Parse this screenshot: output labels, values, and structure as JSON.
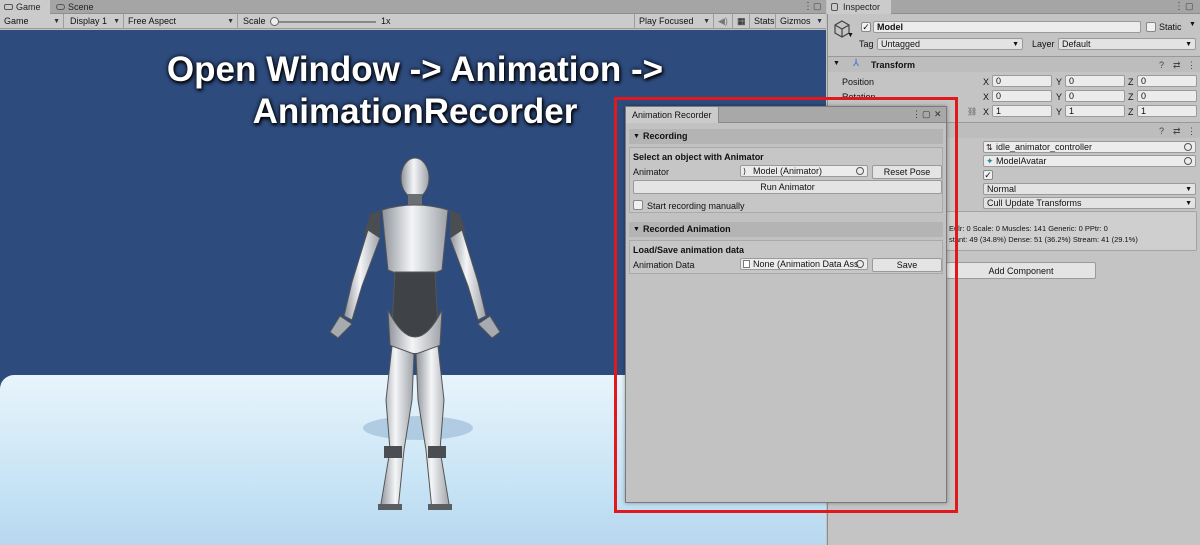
{
  "game_tabs": [
    {
      "label": "Game",
      "active": true
    },
    {
      "label": "Scene",
      "active": false
    }
  ],
  "toolbar": {
    "game_dropdown": "Game",
    "display_dropdown": "Display 1",
    "aspect_dropdown": "Free Aspect",
    "scale_label": "Scale",
    "scale_value": "1x",
    "scale_fraction": 0.0,
    "play_mode_dropdown": "Play Focused",
    "stats_label": "Stats",
    "gizmos_label": "Gizmos"
  },
  "overlay": {
    "line1": "Open Window -> Animation ->",
    "line2": "AnimationRecorder"
  },
  "inspector": {
    "tab_label": "Inspector",
    "object_name": "Model",
    "object_active": true,
    "static_label": "Static",
    "tag_label": "Tag",
    "tag_value": "Untagged",
    "layer_label": "Layer",
    "layer_value": "Default",
    "transform": {
      "title": "Transform",
      "position_label": "Position",
      "rotation_label": "Rotation",
      "position": {
        "x": "0",
        "y": "0",
        "z": "0"
      },
      "rotation": {
        "x": "0",
        "y": "0",
        "z": "0"
      },
      "scale": {
        "x": "1",
        "y": "1",
        "z": "1"
      }
    },
    "axis_x": "X",
    "axis_y": "Y",
    "axis_z": "Z",
    "animator": {
      "controller": "idle_animator_controller",
      "avatar": "ModelAvatar",
      "apply_root_motion": true,
      "update_mode": "Normal",
      "culling_mode": "Cull Update Transforms",
      "info_line1": "Eulr: 0 Scale: 0 Muscles: 141 Generic: 0 PPtr: 0",
      "info_line2": "stant: 49 (34.8%) Dense: 51 (36.2%) Stream: 41 (29.1%)"
    },
    "add_component_label": "Add Component"
  },
  "recorder": {
    "tab_label": "Animation Recorder",
    "recording_section": "Recording",
    "select_heading": "Select an object with Animator",
    "animator_label": "Animator",
    "animator_value": "Model (Animator)",
    "reset_pose_label": "Reset Pose",
    "run_animator_label": "Run Animator",
    "start_manually_label": "Start recording manually",
    "start_manually_checked": false,
    "recorded_section": "Recorded Animation",
    "load_save_heading": "Load/Save animation data",
    "animation_data_label": "Animation Data",
    "animation_data_value": "None (Animation Data Ass",
    "save_label": "Save"
  },
  "colors": {
    "game_background": "#2e4b7d",
    "highlight": "#e0191f",
    "editor_panel": "#c4c4c4"
  }
}
